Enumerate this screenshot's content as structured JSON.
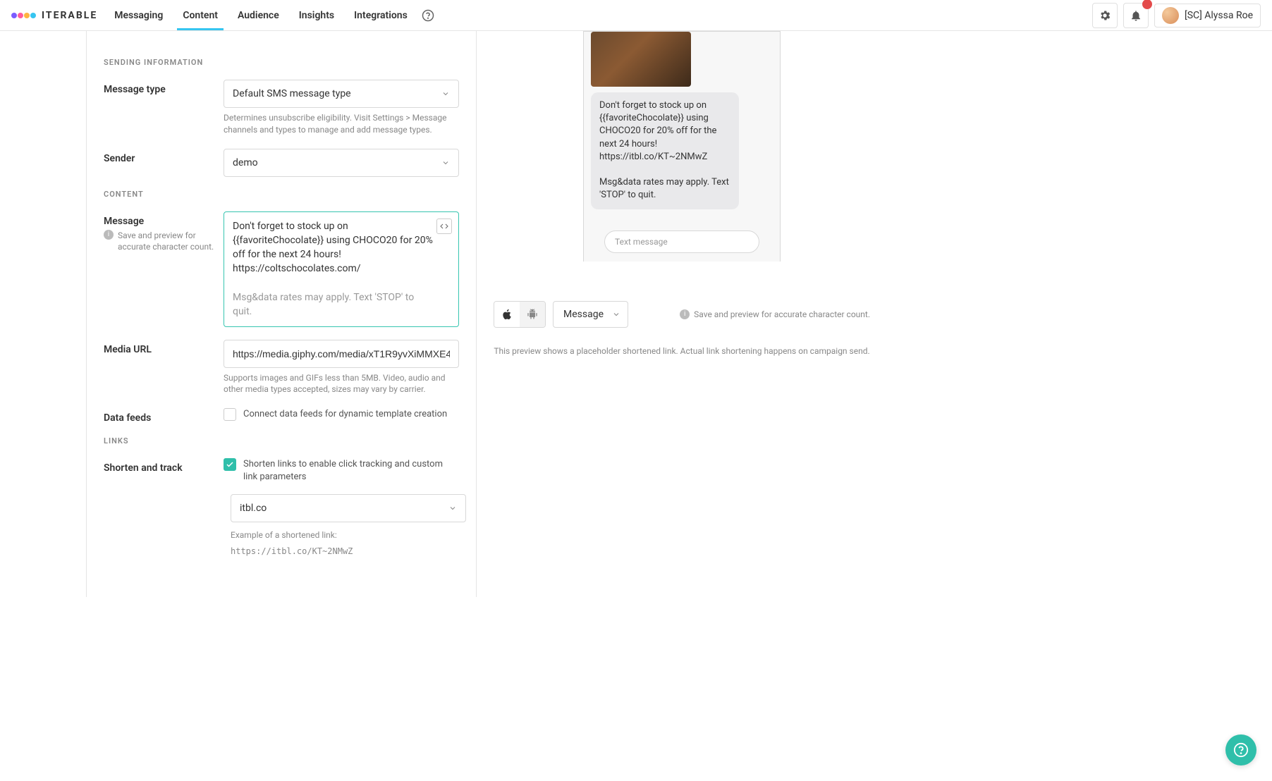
{
  "brand": "ITERABLE",
  "nav": {
    "items": [
      "Messaging",
      "Content",
      "Audience",
      "Insights",
      "Integrations"
    ],
    "active_index": 1,
    "user_label": "[SC] Alyssa Roe"
  },
  "sections": {
    "sending_information": "SENDING INFORMATION",
    "content": "CONTENT",
    "links": "LINKS"
  },
  "fields": {
    "message_type": {
      "label": "Message type",
      "value": "Default SMS message type",
      "helper": "Determines unsubscribe eligibility. Visit Settings > Message channels and types to manage and add message types."
    },
    "sender": {
      "label": "Sender",
      "value": "demo"
    },
    "message": {
      "label": "Message",
      "sublabel": "Save and preview for accurate character count.",
      "body": "Don't forget to stock up on {{favoriteChocolate}} using CHOCO20 for 20% off for the next 24 hours!\nhttps://coltschocolates.com/",
      "footer": "Msg&data rates may apply. Text 'STOP' to quit."
    },
    "media_url": {
      "label": "Media URL",
      "value": "https://media.giphy.com/media/xT1R9yvXiMMXE4",
      "helper": "Supports images and GIFs less than 5MB. Video, audio and other media types accepted, sizes may vary by carrier."
    },
    "data_feeds": {
      "label": "Data feeds",
      "checkbox_label": "Connect data feeds for dynamic template creation",
      "checked": false
    },
    "shorten_track": {
      "label": "Shorten and track",
      "checkbox_label": "Shorten links to enable click tracking and custom link parameters",
      "checked": true,
      "domain": "itbl.co",
      "example_label": "Example of a shortened link:",
      "example_value": "https://itbl.co/KT~2NMwZ"
    }
  },
  "preview": {
    "bubble": "Don't forget to stock up on {{favoriteChocolate}} using CHOCO20 for 20% off for the next 24 hours!\nhttps://itbl.co/KT~2NMwZ\n\nMsg&data rates may apply. Text 'STOP' to quit.",
    "input_placeholder": "Text message",
    "select_label": "Message",
    "note": "Save and preview for accurate character count.",
    "disclaimer": "This preview shows a placeholder shortened link. Actual link shortening happens on campaign send."
  }
}
